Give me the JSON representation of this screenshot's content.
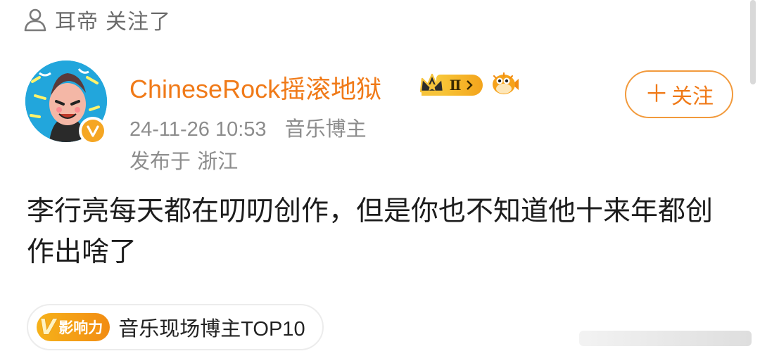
{
  "liked_by": {
    "name": "耳帝",
    "action": "关注了",
    "icon": "person-icon"
  },
  "author": {
    "name": "ChineseRock摇滚地狱",
    "level_badge": "Ⅱ",
    "avatar_verified": "v",
    "follow_label": "关注"
  },
  "post": {
    "timestamp": "24-11-26 10:53",
    "author_category": "音乐博主",
    "location": "发布于 浙江",
    "text": "李行亮每天都在叨叨创作，但是你也不知道他十来年都创作出啥了"
  },
  "influence": {
    "badge_letter": "V",
    "badge_label": "影响力",
    "label": "音乐现场博主TOP10"
  },
  "colors": {
    "accent": "#f07a18",
    "meta_text": "#8c8c8c",
    "body_text": "#1c1c1c",
    "badge_gold": "#f5a623"
  }
}
